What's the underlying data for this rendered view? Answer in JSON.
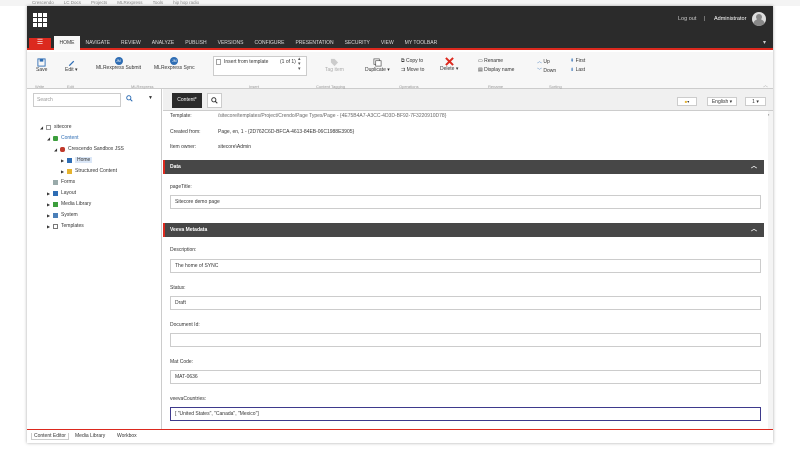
{
  "bookmarks": [
    "Crescendo",
    "LC Docs",
    "Projects",
    "MLRexpress",
    "Tools",
    "hip hop radio"
  ],
  "topbar": {
    "logout": "Log out",
    "separator": "|",
    "user": "Administrator"
  },
  "tabs": [
    "HOME",
    "NAVIGATE",
    "REVIEW",
    "ANALYZE",
    "PUBLISH",
    "VERSIONS",
    "CONFIGURE",
    "PRESENTATION",
    "SECURITY",
    "VIEW",
    "MY TOOLBAR"
  ],
  "ribbon": {
    "save": "Save",
    "edit": "Edit",
    "mlr_submit": "MLRexpress Submit",
    "mlr_sync": "MLRexpress Sync",
    "insert_from_template": "Insert from template",
    "template_count": "(1 of 1)",
    "tag_item": "Tag item",
    "duplicate": "Duplicate",
    "copy_to": "Copy to",
    "move_to": "Move to",
    "delete": "Delete",
    "rename": "Rename",
    "display_name": "Display name",
    "up": "Up",
    "down": "Down",
    "first": "First",
    "last": "Last",
    "groups": [
      "Write",
      "Edit",
      "MLRexpress",
      "Insert",
      "Content Tagging",
      "Operations",
      "Rename",
      "Sorting"
    ]
  },
  "sidebar": {
    "search_placeholder": "Search",
    "tree": [
      {
        "label": "sitecore",
        "depth": 0,
        "expanded": true
      },
      {
        "label": "Content",
        "depth": 1,
        "expanded": true
      },
      {
        "label": "Crescendo Sandbox JSS",
        "depth": 2,
        "expanded": true
      },
      {
        "label": "Home",
        "depth": 3,
        "expanded": false,
        "selected": true
      },
      {
        "label": "Structured Content",
        "depth": 3,
        "expanded": false
      },
      {
        "label": "Forms",
        "depth": 1,
        "expanded": false
      },
      {
        "label": "Layout",
        "depth": 1,
        "expanded": false
      },
      {
        "label": "Media Library",
        "depth": 1,
        "expanded": false
      },
      {
        "label": "System",
        "depth": 1,
        "expanded": false
      },
      {
        "label": "Templates",
        "depth": 1,
        "expanded": false
      }
    ]
  },
  "content": {
    "tab_label": "Content",
    "language": "English",
    "version": "1",
    "template_label": "Template:",
    "template_value": "/sitecore/templates/Project/Crendo/Page Types/Page - {4E75B4A7-A3CC-4D3D-BF92-7F3220910D78}",
    "created_from_label": "Created from:",
    "created_from_value": "Page, en, 1 - {2D762C6D-BFCA-4613-84EB-06C1988E3905}",
    "item_owner_label": "Item owner:",
    "item_owner_value": "sitecore\\Admin",
    "sections": {
      "data": "Data",
      "veeva": "Veeva Metadata"
    },
    "fields": {
      "page_title_label": "pageTitle:",
      "page_title_value": "Sitecore demo page",
      "description_label": "Description:",
      "description_value": "The home of SYNC",
      "status_label": "Status:",
      "status_value": "Draft",
      "document_id_label": "Document Id:",
      "document_id_value": "",
      "mat_code_label": "Mat Code:",
      "mat_code_value": "MAT-0636",
      "countries_label": "veevaCountries:",
      "countries_value": "[ \"United States\", \"Canada\", \"Mexico\"]"
    }
  },
  "bottom_tabs": [
    "Content Editor",
    "Media Library",
    "Workbox"
  ],
  "colors": {
    "accent": "#dc291e",
    "dark": "#2b2b2b",
    "section": "#474747",
    "focus": "#3e3a8c"
  }
}
